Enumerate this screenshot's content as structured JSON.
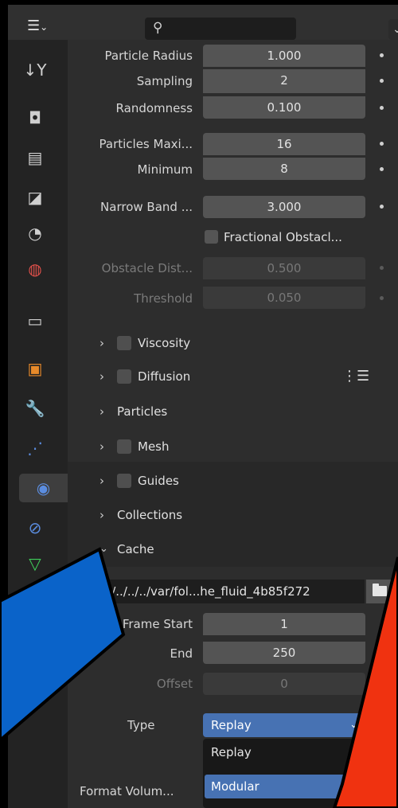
{
  "header": {
    "search_placeholder": ""
  },
  "tabs": [
    {
      "name": "tool-tab-icon",
      "glyph": "↓Y",
      "color": "#cfcfcf"
    },
    {
      "name": "render-tab-icon",
      "glyph": "◘",
      "color": "#cfcfcf"
    },
    {
      "name": "output-tab-icon",
      "glyph": "▤",
      "color": "#cfcfcf"
    },
    {
      "name": "view-layer-tab-icon",
      "glyph": "◪",
      "color": "#cfcfcf"
    },
    {
      "name": "scene-tab-icon",
      "glyph": "◔",
      "color": "#cfcfcf"
    },
    {
      "name": "world-tab-icon",
      "glyph": "◍",
      "color": "#e0504a"
    },
    {
      "name": "collection-tab-icon",
      "glyph": "▭",
      "color": "#cfcfcf"
    },
    {
      "name": "object-tab-icon",
      "glyph": "▣",
      "color": "#e88a2a"
    },
    {
      "name": "modifier-tab-icon",
      "glyph": "🔧",
      "color": "#5b8de0"
    },
    {
      "name": "particles-tab-icon",
      "glyph": "⋰",
      "color": "#5b8de0"
    },
    {
      "name": "physics-tab-icon",
      "glyph": "◉",
      "color": "#5b8de0"
    },
    {
      "name": "constraints-tab-icon",
      "glyph": "⊘",
      "color": "#5b8de0"
    },
    {
      "name": "data-tab-icon",
      "glyph": "▽",
      "color": "#3fcf5a"
    },
    {
      "name": "material-tab-icon",
      "glyph": "◑",
      "color": "#e0504a"
    }
  ],
  "fields": {
    "particle_radius": {
      "label": "Particle Radius",
      "value": "1.000"
    },
    "sampling": {
      "label": "Sampling",
      "value": "2"
    },
    "randomness": {
      "label": "Randomness",
      "value": "0.100"
    },
    "particles_maximum": {
      "label": "Particles Maxi...",
      "value": "16"
    },
    "minimum": {
      "label": "Minimum",
      "value": "8"
    },
    "narrow_band": {
      "label": "Narrow Band ...",
      "value": "3.000"
    },
    "fractional_obstacles": {
      "label": "Fractional Obstacl..."
    },
    "obstacle_distance": {
      "label": "Obstacle Dist...",
      "value": "0.500"
    },
    "threshold": {
      "label": "Threshold",
      "value": "0.050"
    }
  },
  "sections": {
    "viscosity": "Viscosity",
    "diffusion": "Diffusion",
    "particles": "Particles",
    "mesh": "Mesh",
    "guides": "Guides",
    "collections": "Collections",
    "cache": "Cache"
  },
  "cache": {
    "directory": "//../../../../../var/fol...he_fluid_4b85f272",
    "frame_start": {
      "label": "Frame Start",
      "value": "1"
    },
    "end": {
      "label": "End",
      "value": "250"
    },
    "offset": {
      "label": "Offset",
      "value": "0"
    },
    "type": {
      "label": "Type",
      "value": "Replay"
    },
    "type_options": [
      "Replay",
      "Modular"
    ],
    "format_volumes": {
      "label": "Format Volum..."
    }
  },
  "colors": {
    "accent": "#4772b3",
    "annotation_blue": "#0a63c9",
    "annotation_red": "#f03210"
  }
}
